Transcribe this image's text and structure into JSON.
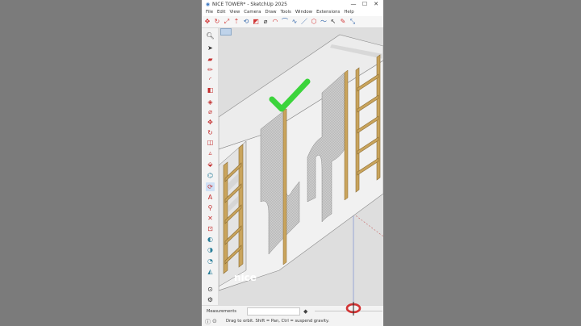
{
  "window": {
    "title": "NICE TOWER* - SketchUp 2025",
    "controls": [
      "—",
      "☐",
      "✕"
    ]
  },
  "menu": [
    "File",
    "Edit",
    "View",
    "Camera",
    "Draw",
    "Tools",
    "Window",
    "Extensions",
    "Help"
  ],
  "toolbar_icons": [
    "move-icon",
    "rotate-icon",
    "scale-icon",
    "push-pull-icon",
    "follow-me-icon",
    "offset-icon",
    "tape-measure-icon",
    "protractor-icon",
    "arc-icon",
    "freehand-icon",
    "line-icon",
    "select-icon"
  ],
  "sidebar_icons": [
    "zoom-icon",
    "select-icon",
    "eraser-icon",
    "pencil-icon",
    "arc-icon",
    "rectangle-icon",
    "paint-bucket-icon",
    "tape-icon",
    "move-icon",
    "rotate-icon",
    "scale-icon",
    "push-pull-icon",
    "follow-me-icon",
    "offset-icon",
    "text-icon",
    "axes-icon",
    "dimension-icon",
    "orbit-icon",
    "pan-icon",
    "zoom-window-icon",
    "zoom-extents-icon",
    "walk-icon",
    "section-plane-icon",
    "look-around-icon"
  ],
  "watermark": "nice",
  "status": {
    "measurements_label": "Measurements",
    "hint": "Drag to orbit. Shift = Pan, Ctrl = suspend gravity."
  },
  "colors": {
    "check": "#3bd43b",
    "accent_red": "#d13434",
    "frame": "#c9a45c"
  }
}
